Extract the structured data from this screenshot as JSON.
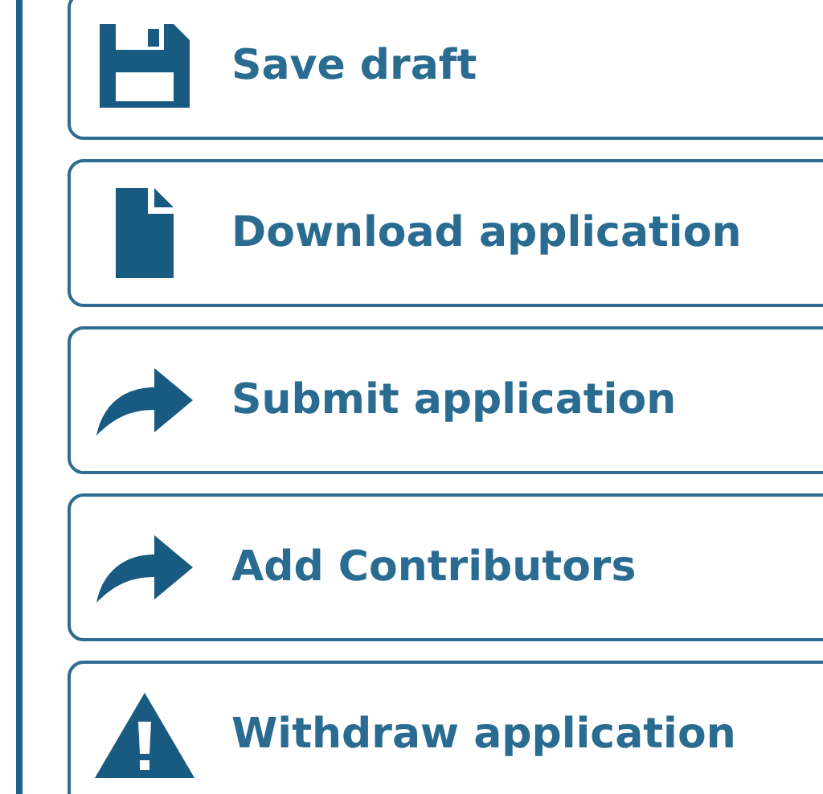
{
  "actions": [
    {
      "kind": "save",
      "label": "Save draft"
    },
    {
      "kind": "document",
      "label": "Download application"
    },
    {
      "kind": "forward",
      "label": "Submit application"
    },
    {
      "kind": "forward",
      "label": "Add Contributors"
    },
    {
      "kind": "warning",
      "label": "Withdraw application"
    }
  ]
}
